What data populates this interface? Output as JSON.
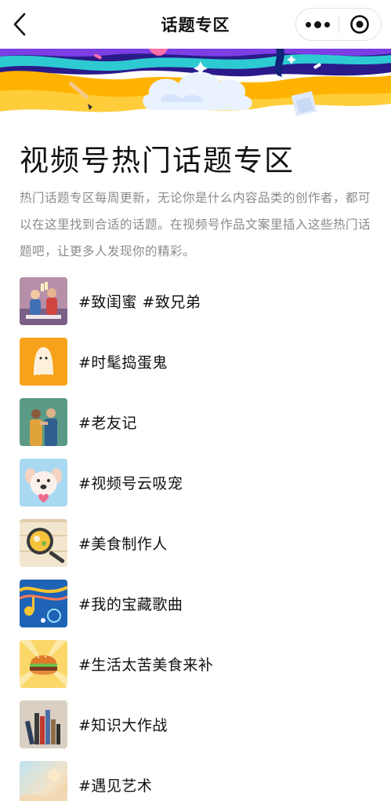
{
  "nav": {
    "title": "话题专区",
    "back_icon": "chevron-left-icon",
    "more_icon": "more-dots-icon",
    "close_icon": "target-close-icon"
  },
  "banner": {
    "colors": [
      "#ffb300",
      "#7b3fe4",
      "#2ecad2",
      "#f5f0ff",
      "#12247a"
    ]
  },
  "page": {
    "title": "视频号热门话题专区",
    "description": "热门话题专区每周更新，无论你是什么内容品类的创作者，都可以在这里找到合适的话题。在视频号作品文案里插入这些热门话题吧，让更多人发现你的精彩。"
  },
  "topics": [
    {
      "label": "#致闺蜜 #致兄弟",
      "thumb": "friends-toast"
    },
    {
      "label": "#时髦捣蛋鬼",
      "thumb": "ghost"
    },
    {
      "label": "#老友记",
      "thumb": "old-friends"
    },
    {
      "label": "#视频号云吸宠",
      "thumb": "puppy"
    },
    {
      "label": "#美食制作人",
      "thumb": "food-pan"
    },
    {
      "label": "#我的宝藏歌曲",
      "thumb": "music"
    },
    {
      "label": "#生活太苦美食来补",
      "thumb": "burger"
    },
    {
      "label": "#知识大作战",
      "thumb": "books"
    },
    {
      "label": "#遇见艺术",
      "thumb": "art"
    }
  ]
}
